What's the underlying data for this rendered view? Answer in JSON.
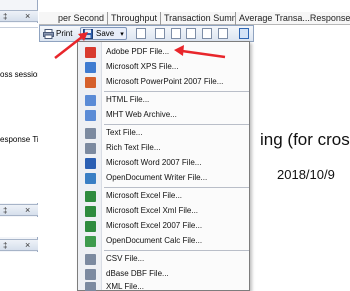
{
  "left_panel": {
    "pin_glyph": "‡",
    "close_glyph": "×",
    "row1": "oss session",
    "row2": "esponse Tir"
  },
  "column_headers": [
    "per Second",
    "Throughput",
    "Transaction Summary",
    "Average Transa...Response Time"
  ],
  "toolbar": {
    "print_label": "Print",
    "save_label": "Save",
    "dropdown_glyph": "▾"
  },
  "menu": {
    "items": [
      {
        "label": "Adobe PDF File...",
        "icon": "pdf-icon",
        "color": "#d83b2f"
      },
      {
        "label": "Microsoft XPS File...",
        "icon": "xps-icon",
        "color": "#3e7bd0"
      },
      {
        "label": "Microsoft PowerPoint 2007 File...",
        "icon": "powerpoint-icon",
        "color": "#d5602c"
      },
      {
        "label": "HTML File...",
        "icon": "html-icon",
        "color": "#5a8bd6"
      },
      {
        "label": "MHT Web Archive...",
        "icon": "mht-icon",
        "color": "#5a8bd6"
      },
      {
        "label": "Text File...",
        "icon": "text-file-icon",
        "color": "#7c8aa0"
      },
      {
        "label": "Rich Text File...",
        "icon": "rich-text-icon",
        "color": "#7c8aa0"
      },
      {
        "label": "Microsoft Word 2007 File...",
        "icon": "word-icon",
        "color": "#2b5fb3"
      },
      {
        "label": "OpenDocument Writer File...",
        "icon": "odt-icon",
        "color": "#3a7fc4"
      },
      {
        "label": "Microsoft Excel File...",
        "icon": "excel-icon",
        "color": "#2e8b3e"
      },
      {
        "label": "Microsoft Excel Xml File...",
        "icon": "excel-xml-icon",
        "color": "#2e8b3e"
      },
      {
        "label": "Microsoft Excel 2007 File...",
        "icon": "excel-2007-icon",
        "color": "#2e8b3e"
      },
      {
        "label": "OpenDocument Calc File...",
        "icon": "ods-icon",
        "color": "#3e9b4d"
      },
      {
        "label": "CSV File...",
        "icon": "csv-icon",
        "color": "#7c8aa0"
      },
      {
        "label": "dBase DBF File...",
        "icon": "dbf-icon",
        "color": "#7c8aa0"
      },
      {
        "label": "XML File...",
        "icon": "xml-icon",
        "color": "#7c8aa0"
      }
    ]
  },
  "report": {
    "title_fragment": "ing (for cross",
    "date": "2018/10/9"
  },
  "colors": {
    "annotation_arrow": "#e8262b",
    "menu_border": "#7d7d7d",
    "toolbar_border": "#8fa3c0"
  }
}
